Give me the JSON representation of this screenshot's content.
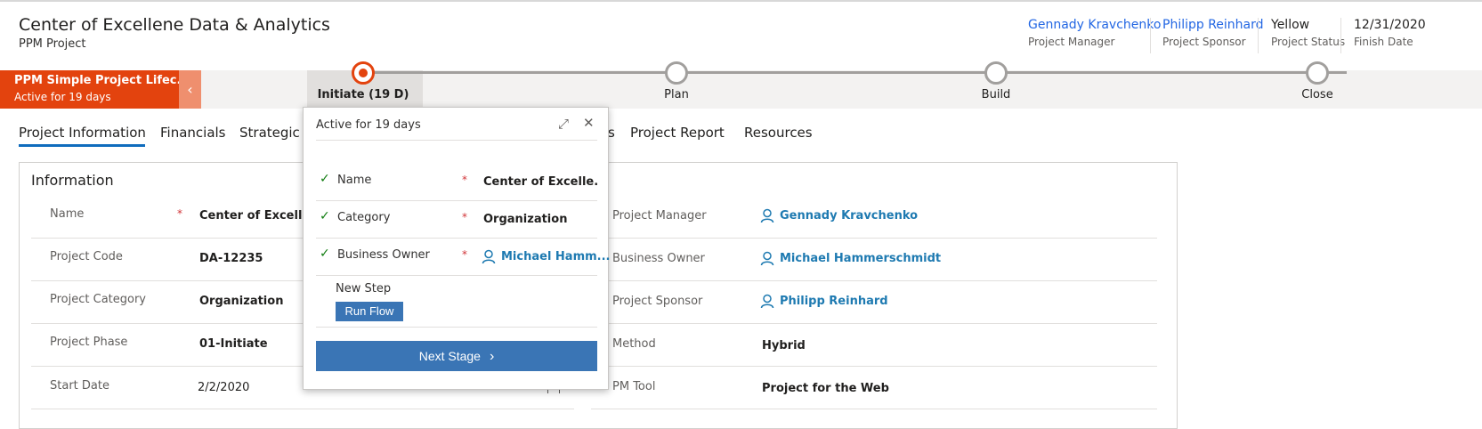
{
  "header": {
    "title": "Center of Excellene Data & Analytics",
    "subtitle": "PPM Project",
    "fields": [
      {
        "value": "Gennady Kravchenko",
        "label": "Project Manager"
      },
      {
        "value": "Philipp Reinhard",
        "label": "Project Sponsor"
      },
      {
        "value": "Yellow",
        "label": "Project Status"
      },
      {
        "value": "12/31/2020",
        "label": "Finish Date"
      }
    ]
  },
  "bpf": {
    "process_name": "PPM Simple Project Lifec...",
    "process_status": "Active for 19 days",
    "collapse_glyph": "‹",
    "stages": [
      {
        "label": "Initiate  (19 D)"
      },
      {
        "label": "Plan"
      },
      {
        "label": "Build"
      },
      {
        "label": "Close"
      }
    ]
  },
  "tabs": [
    {
      "label": "Project Information"
    },
    {
      "label": "Financials"
    },
    {
      "label": "Strategic A"
    },
    {
      "label": "s"
    },
    {
      "label": "Project Report"
    },
    {
      "label": "Resources"
    }
  ],
  "section": {
    "title": "Information",
    "left_fields": [
      {
        "label": "Name",
        "value": "Center of Excellene",
        "required": "*"
      },
      {
        "label": "Project Code",
        "value": "DA-12235"
      },
      {
        "label": "Project Category",
        "value": "Organization"
      },
      {
        "label": "Project Phase",
        "value": "01-Initiate"
      },
      {
        "label": "Start Date",
        "value": "2/2/2020"
      }
    ],
    "right_fields": [
      {
        "label": "Project Manager",
        "value": "Gennady Kravchenko"
      },
      {
        "label": "Business Owner",
        "value": "Michael Hammerschmidt"
      },
      {
        "label": "Project Sponsor",
        "value": "Philipp Reinhard"
      },
      {
        "label": "Method",
        "value": "Hybrid"
      },
      {
        "label": "PM Tool",
        "value": "Project for the Web"
      }
    ]
  },
  "flyout": {
    "header": "Active for 19 days",
    "expand_glyph": "⤢",
    "close_glyph": "✕",
    "check_glyph": "✓",
    "required_mark": "*",
    "fields": [
      {
        "label": "Name",
        "value": "Center of Excelle..."
      },
      {
        "label": "Category",
        "value": "Organization"
      },
      {
        "label": "Business Owner",
        "value": "Michael Hamm..."
      }
    ],
    "new_step_label": "New Step",
    "run_flow_label": "Run Flow",
    "next_stage_label": "Next Stage",
    "next_glyph": "›"
  },
  "colors": {
    "accent_orange": "#e3430e",
    "link_blue": "#2266e3",
    "lookup_blue": "#1e7ab1",
    "button_blue": "#3a75b5"
  }
}
